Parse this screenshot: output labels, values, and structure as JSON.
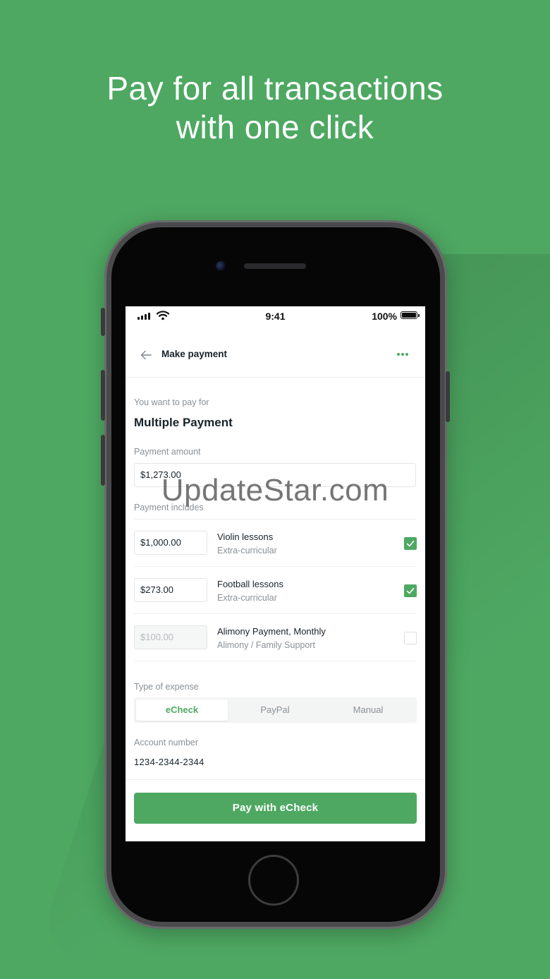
{
  "headline": {
    "line1": "Pay for all transactions",
    "line2": "with one click"
  },
  "colors": {
    "background": "#4ea862",
    "accent": "#4ea862",
    "text_dark": "#17232b",
    "text_muted": "#8a9196"
  },
  "status_bar": {
    "time": "9:41",
    "battery": "100%"
  },
  "nav": {
    "title": "Make payment",
    "back_icon": "arrow-left-icon",
    "more_icon": "more-dots-icon"
  },
  "form": {
    "pay_for_label": "You want to pay for",
    "pay_for_value": "Multiple Payment",
    "amount_label": "Payment amount",
    "amount_value": "$1,273.00",
    "includes_label": "Payment includes",
    "items": [
      {
        "amount": "$1,000.00",
        "name": "Violin lessons",
        "category": "Extra-curricular",
        "checked": true
      },
      {
        "amount": "$273.00",
        "name": "Football lessons",
        "category": "Extra-curricular",
        "checked": true
      },
      {
        "amount": "$100.00",
        "name": "Alimony Payment, Monthly",
        "category": "Alimony / Family Support",
        "checked": false
      }
    ],
    "expense_label": "Type of expense",
    "expense_options": [
      "eCheck",
      "PayPal",
      "Manual"
    ],
    "expense_selected": "eCheck",
    "account_label": "Account number",
    "account_value": "1234-2344-2344"
  },
  "pay_button": "Pay with eCheck",
  "watermark": "UpdateStar.com"
}
